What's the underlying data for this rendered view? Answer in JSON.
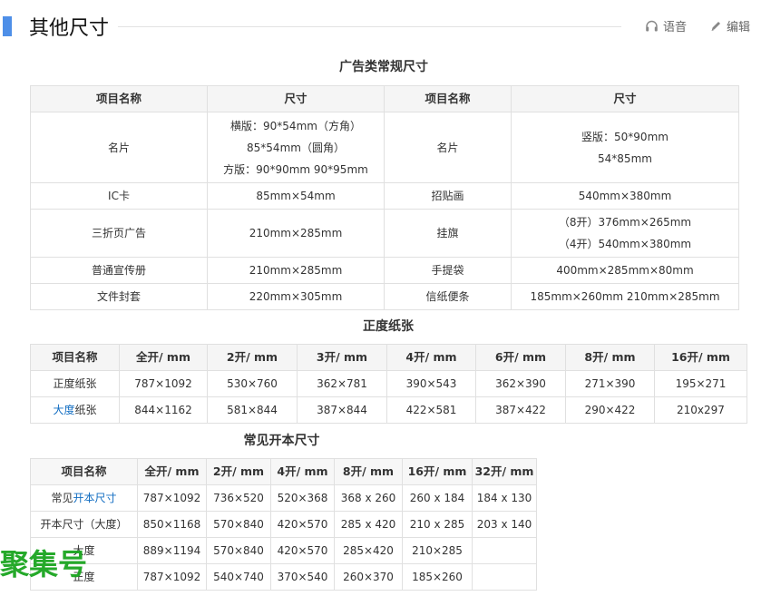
{
  "page": {
    "title": "其他尺寸",
    "voice_label": "语音",
    "edit_label": "编辑",
    "accent_color": "#4e8fe8",
    "link_color": "#136ec2",
    "watermark_text": "聚集号",
    "watermark_color": "#1aa51f"
  },
  "table1": {
    "caption": "广告类常规尺寸",
    "headers": [
      "项目名称",
      "尺寸",
      "项目名称",
      "尺寸"
    ],
    "rows": [
      {
        "name1": "名片",
        "size1": [
          "横版：90*54mm（方角）",
          "85*54mm（圆角）",
          "方版：90*90mm 90*95mm"
        ],
        "name2": "名片",
        "size2": [
          "竖版：50*90mm",
          "54*85mm"
        ]
      },
      {
        "name1": "IC卡",
        "size1": [
          "85mm×54mm"
        ],
        "name2": "招贴画",
        "size2": [
          "540mm×380mm"
        ]
      },
      {
        "name1": "三折页广告",
        "size1": [
          "210mm×285mm"
        ],
        "name2": "挂旗",
        "size2": [
          "（8开）376mm×265mm",
          "（4开）540mm×380mm"
        ]
      },
      {
        "name1": "普通宣传册",
        "size1": [
          "210mm×285mm"
        ],
        "name2": "手提袋",
        "size2": [
          "400mm×285mm×80mm"
        ]
      },
      {
        "name1": "文件封套",
        "size1": [
          "220mm×305mm"
        ],
        "name2": "信纸便条",
        "size2": [
          "185mm×260mm 210mm×285mm"
        ]
      }
    ]
  },
  "table2": {
    "caption": "正度纸张",
    "headers": [
      "项目名称",
      "全开/ mm",
      "2开/ mm",
      "3开/ mm",
      "4开/ mm",
      "6开/ mm",
      "8开/ mm",
      "16开/ mm"
    ],
    "rows": [
      [
        "正度纸张",
        "787×1092",
        "530×760",
        "362×781",
        "390×543",
        "362×390",
        "271×390",
        "195×271"
      ],
      [
        "大度纸张",
        "844×1162",
        "581×844",
        "387×844",
        "422×581",
        "387×422",
        "290×422",
        "210x297"
      ]
    ]
  },
  "table3": {
    "caption": "常见开本尺寸",
    "headers": [
      "项目名称",
      "全开/ mm",
      "2开/ mm",
      "4开/ mm",
      "8开/ mm",
      "16开/ mm",
      "32开/ mm"
    ],
    "rows": [
      [
        "常见开本尺寸",
        "787×1092",
        "736×520",
        "520×368",
        "368 x 260",
        "260 x 184",
        "184 x 130"
      ],
      [
        "开本尺寸（大度）",
        "850×1168",
        "570×840",
        "420×570",
        "285 x 420",
        "210 x 285",
        "203 x 140"
      ],
      [
        "大度",
        "889×1194",
        "570×840",
        "420×570",
        "285×420",
        "210×285",
        ""
      ],
      [
        "正度",
        "787×1092",
        "540×740",
        "370×540",
        "260×370",
        "185×260",
        ""
      ]
    ]
  }
}
